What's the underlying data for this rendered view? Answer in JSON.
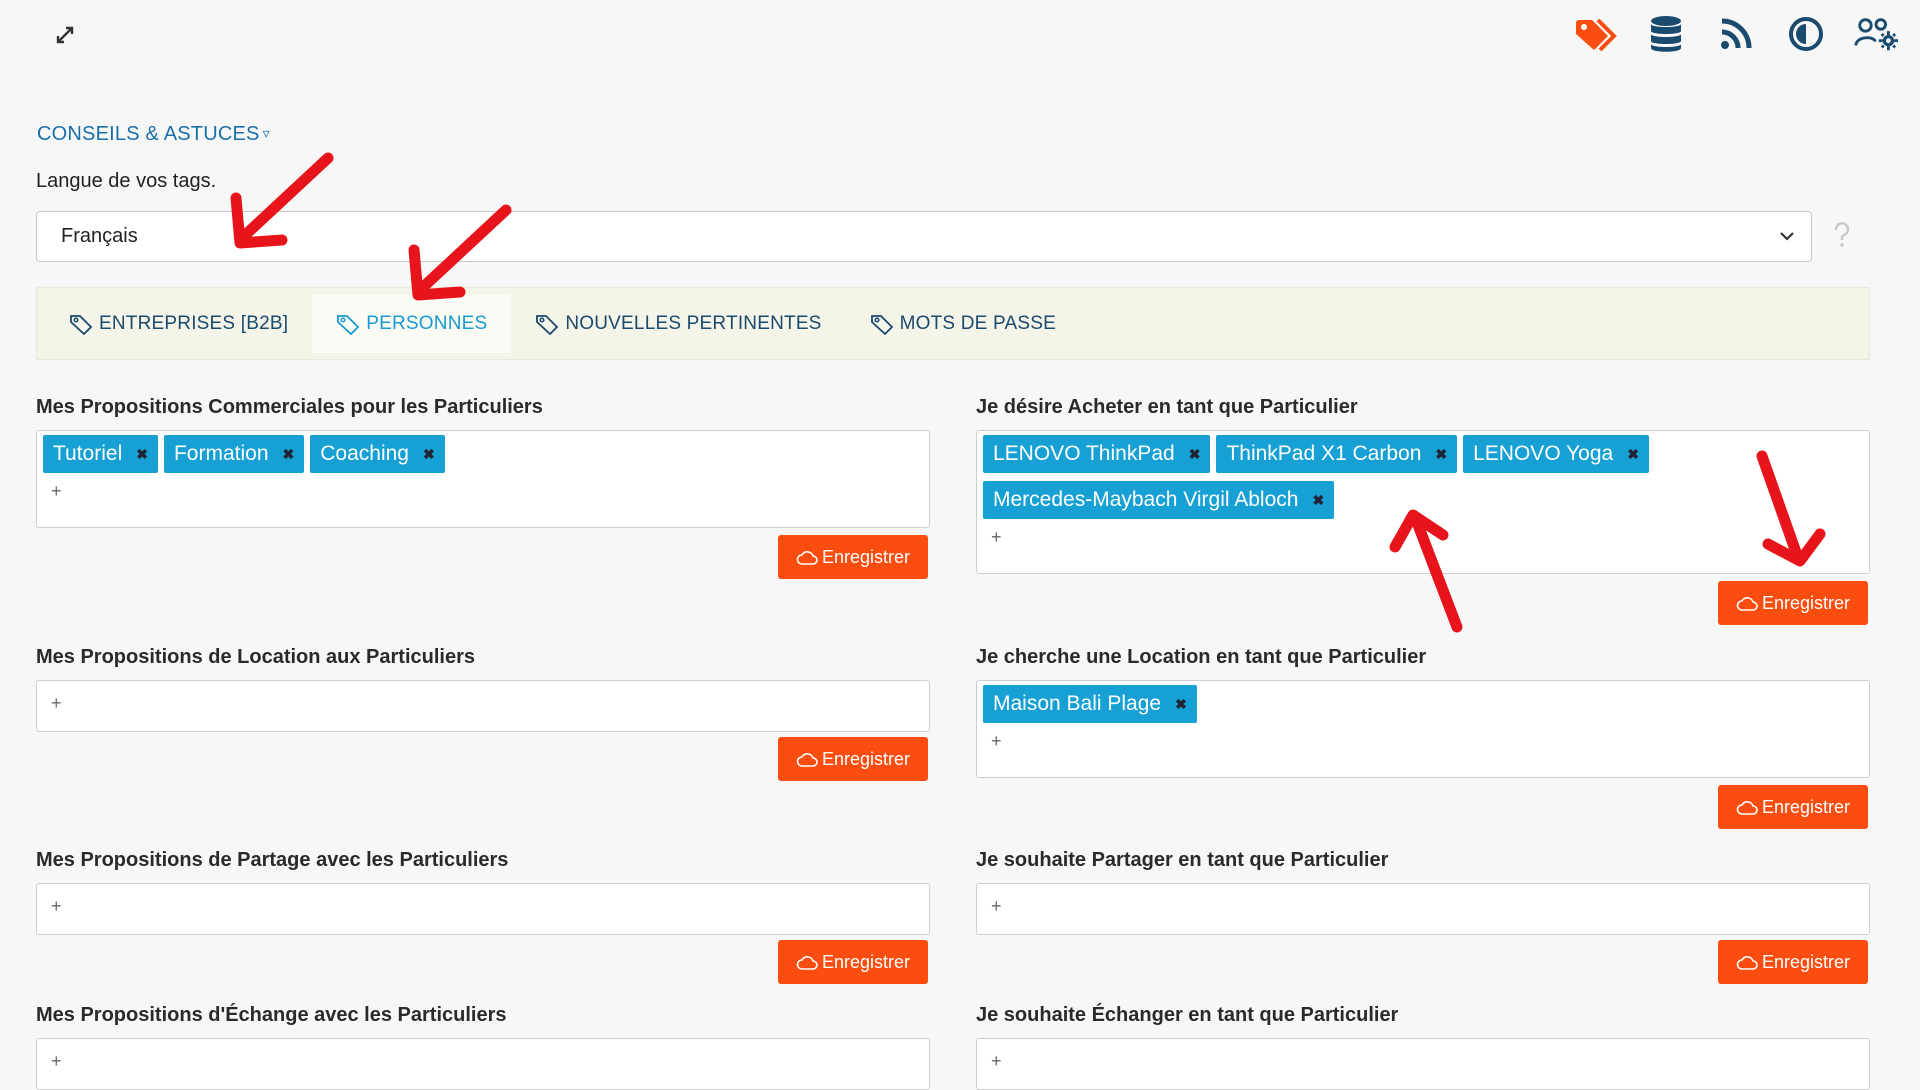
{
  "header": {
    "expand_icon": "expand-arrows-icon",
    "icons": [
      "tags-icon",
      "database-icon",
      "rss-icon",
      "contrast-icon",
      "users-cog-icon"
    ],
    "colors": {
      "tags": "#fb4d0f",
      "default": "#1a4a6e"
    }
  },
  "tips": {
    "label": "CONSEILS & ASTUCES",
    "caret": "▿"
  },
  "language": {
    "label": "Langue de vos tags.",
    "selected": "Français"
  },
  "tabs": [
    {
      "label": "ENTREPRISES [B2B]",
      "active": false
    },
    {
      "label": "PERSONNES",
      "active": true
    },
    {
      "label": "NOUVELLES PERTINENTES",
      "active": false
    },
    {
      "label": "MOTS DE PASSE",
      "active": false
    }
  ],
  "sections": {
    "left": [
      {
        "title": "Mes Propositions Commerciales pour les Particuliers",
        "tags": [
          "Tutoriel",
          "Formation",
          "Coaching"
        ]
      },
      {
        "title": "Mes Propositions de Location aux Particuliers",
        "tags": []
      },
      {
        "title": "Mes Propositions de Partage avec les Particuliers",
        "tags": []
      },
      {
        "title": "Mes Propositions d'Échange avec les Particuliers",
        "tags": []
      }
    ],
    "right": [
      {
        "title": "Je désire Acheter en tant que Particulier",
        "tags": [
          "LENOVO ThinkPad",
          "ThinkPad X1 Carbon",
          "LENOVO Yoga",
          "Mercedes-Maybach Virgil Abloch"
        ]
      },
      {
        "title": "Je cherche une Location en tant que Particulier",
        "tags": [
          "Maison Bali Plage"
        ]
      },
      {
        "title": "Je souhaite Partager en tant que Particulier",
        "tags": []
      },
      {
        "title": "Je souhaite Échanger en tant que Particulier",
        "tags": []
      }
    ]
  },
  "add_symbol": "+",
  "remove_symbol": "✖",
  "save_label": "Enregistrer",
  "accent_colors": {
    "tag": "#16a0d4",
    "save": "#fb4d0f",
    "annotation_arrow": "#e8141c"
  }
}
